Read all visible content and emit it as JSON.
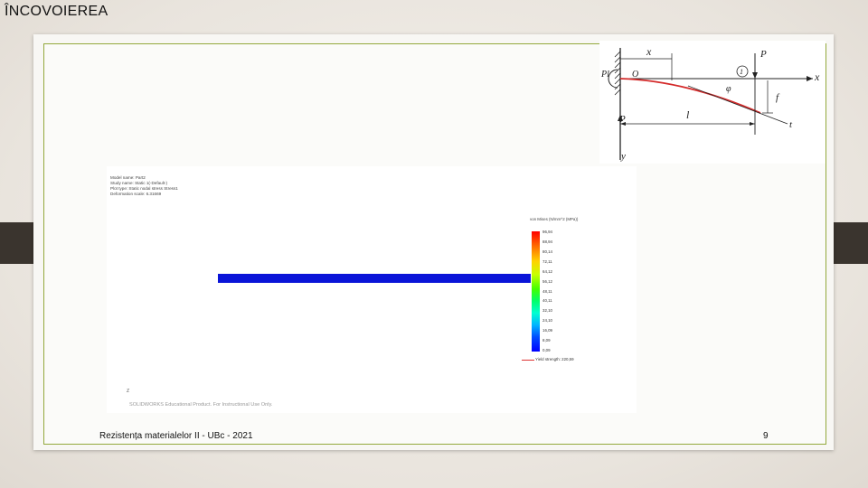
{
  "slide": {
    "title": "ÎNCOVOIEREA",
    "footer": "Rezistența materialelor II -  UBc - 2021",
    "page_number": "9"
  },
  "diagram": {
    "labels": {
      "x_top": "x",
      "p_top": "P",
      "pl": "Pl",
      "origin": "O",
      "circle_1": "1",
      "x_axis": "x",
      "phi": "φ",
      "f": "f",
      "p_bottom": "P",
      "length": "l",
      "t": "t",
      "y_axis": "y"
    },
    "colors": {
      "elastic_line": "#d42b2b",
      "ink": "#222222"
    }
  },
  "simulation": {
    "header_lines": [
      "Model name: Part2",
      "Study name: Static 1(-Default-)",
      "Plot type: Static nodal stress Stress1",
      "Deformation scale: 6.31669"
    ],
    "legend_title": "von Mises (N/mm^2 (MPa))",
    "ticks": [
      "96,94",
      "88,94",
      "80,14",
      "72,11",
      "64,12",
      "56,12",
      "48,11",
      "40,11",
      "32,10",
      "24,10",
      "16,09",
      "8,09",
      "0,09"
    ],
    "yield_label": "Yield strength: 220,59",
    "triad_label": "Z",
    "watermark": "SOLIDWORKS Educational Product. For Instructional Use Only.",
    "colors": {
      "beam": "#0a14d8",
      "yield": "#dd3333"
    }
  }
}
